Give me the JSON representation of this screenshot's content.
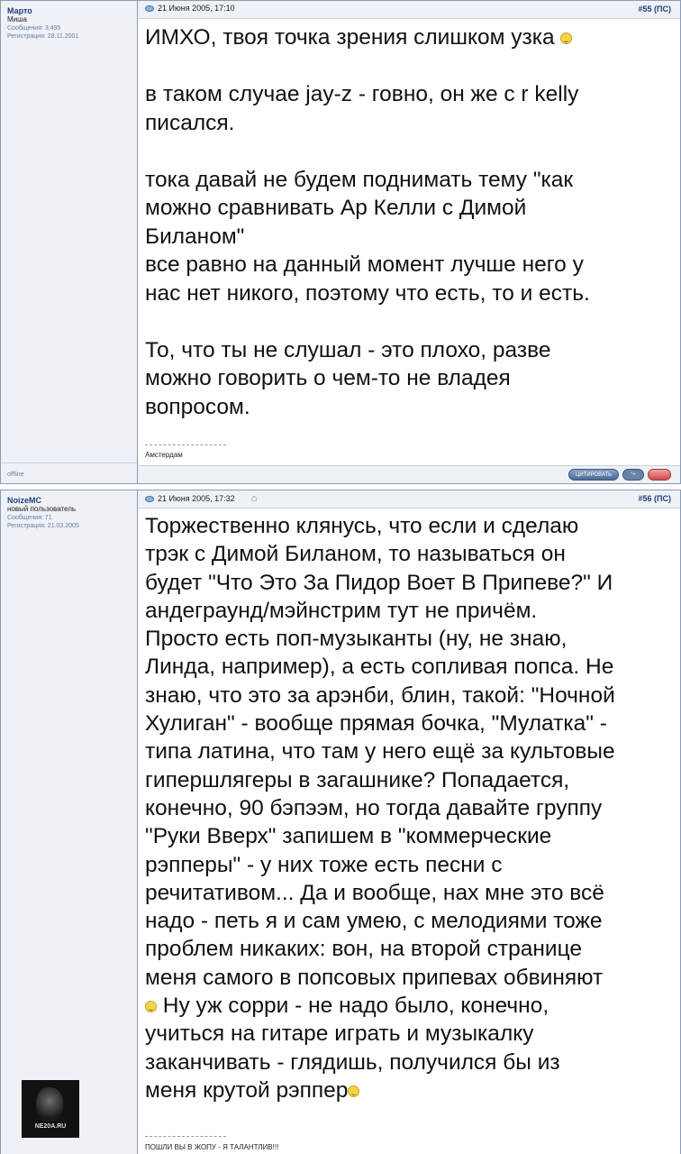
{
  "posts": [
    {
      "user": {
        "name": "Марто",
        "title": "Миша",
        "messages": "Сообщения: 3,495",
        "registered": "Регистрация: 28.11.2001",
        "status": "offline"
      },
      "date": "21 Июня 2005, 17:10",
      "number": "#55",
      "ps": "(ПС)",
      "lines": [
        [
          "ИМХО, твоя точка зрения слишком узка"
        ],
        [
          "в таком случае jay-z - говно, он же с r kelly",
          "писался."
        ],
        [
          "тока давай не будем поднимать тему \"как",
          "можно сравнивать Ар Келли с Димой",
          "Биланом\"",
          "все равно на данный момент лучше него у",
          "нас нет никого, поэтому что есть, то и есть."
        ],
        [
          "То, что ты не слушал - это плохо, разве",
          "можно говорить о чем-то не владея",
          "вопросом."
        ]
      ],
      "signature": "Амстердам",
      "buttons": {
        "quote": "ЦИТИРОВАТЬ",
        "multi": "\"+",
        "report": ""
      }
    },
    {
      "user": {
        "name": "NoizeMC",
        "title": "новый пользователь",
        "messages": "Сообщения: 71",
        "registered": "Регистрация: 21.03.2005",
        "avatar_text": "NE20A.RU"
      },
      "date": "21 Июня 2005, 17:32",
      "number": "#56",
      "ps": "(ПС)",
      "lines": [
        "Торжественно клянусь, что если и сделаю",
        "трэк с Димой Биланом, то называться он",
        "будет \"Что Это За Пидор Воет В Припеве?\" И",
        "андеграунд/мэйнстрим тут не причём.",
        "Просто есть поп-музыканты (ну, не знаю,",
        "Линда, например), а есть сопливая попса. Не",
        "знаю, что это за арэнби, блин, такой: \"Ночной",
        "Хулиган\" - вообще прямая бочка, \"Мулатка\" -",
        "типа латина, что там у него ещё за культовые",
        "гипершлягеры в загашнике? Попадается,",
        "конечно, 90 бэпээм, но тогда давайте группу",
        "\"Руки Вверх\" запишем в \"коммерческие",
        "рэпперы\" - у них тоже есть песни с",
        "речитативом... Да и вообще, нах мне это всё",
        "надо - петь я и сам умею, с мелодиями тоже",
        "проблем никаких: вон, на второй странице",
        "меня самого в попсовых припевах обвиняют",
        " Ну уж сорри - не надо было, конечно,",
        "учиться на гитаре играть и музыкалку",
        "заканчивать - глядишь, получился бы из",
        "меня крутой рэппер"
      ],
      "signature": "ПОШЛИ ВЫ В ЖОПУ - Я ТАЛАНТЛИВ!!!"
    }
  ]
}
